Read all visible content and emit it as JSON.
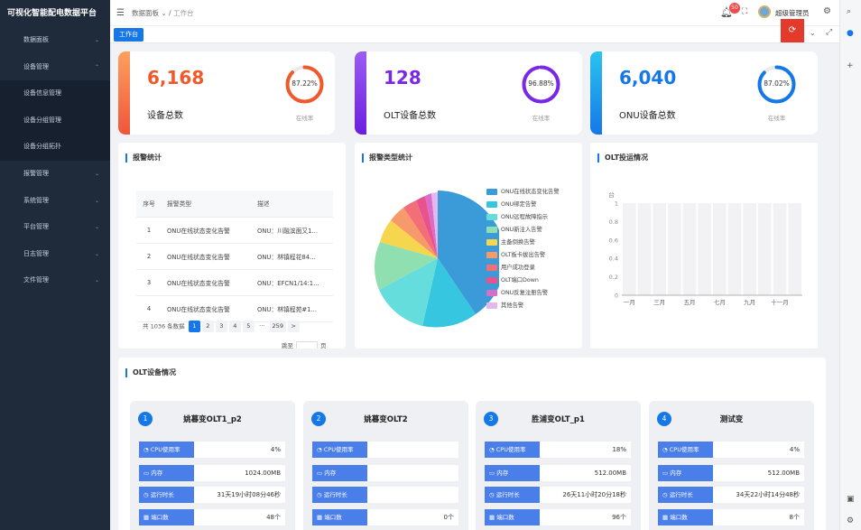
{
  "app": {
    "title": "可视化智能配电数据平台"
  },
  "sidebar": {
    "items": [
      {
        "label": "数据面板",
        "chev": "⌄"
      },
      {
        "label": "设备管理",
        "chev": "⌃"
      },
      {
        "label": "设备信息管理",
        "chev": ""
      },
      {
        "label": "设备分组管理",
        "chev": ""
      },
      {
        "label": "设备分组拓扑",
        "chev": ""
      },
      {
        "label": "报警管理",
        "chev": "⌄"
      },
      {
        "label": "系统管理",
        "chev": "⌄"
      },
      {
        "label": "平台管理",
        "chev": "⌄"
      },
      {
        "label": "日志管理",
        "chev": "⌄"
      },
      {
        "label": "文件管理",
        "chev": "⌄"
      }
    ]
  },
  "header": {
    "breadcrumb": "数据面板 ⌄ / ",
    "breadcrumb_current": "工作台",
    "notify_count": "50",
    "user": "超级管理员"
  },
  "tabs": {
    "active": "工作台"
  },
  "stats": [
    {
      "value": "6,168",
      "label": "设备总数",
      "pct": "87.22%",
      "pct_label": "在线率",
      "ratio": 0.8722,
      "color": "#f05a2a",
      "grad_top": "#fda05f",
      "grad_bot": "#f0553c"
    },
    {
      "value": "128",
      "label": "OLT设备总数",
      "pct": "96.88%",
      "pct_label": "在线率",
      "ratio": 0.9688,
      "color": "#7a28e8",
      "grad_top": "#9b5cf2",
      "grad_bot": "#6a1fe0"
    },
    {
      "value": "6,040",
      "label": "ONU设备总数",
      "pct": "87.02%",
      "pct_label": "在线率",
      "ratio": 0.8702,
      "color": "#1677e8",
      "grad_top": "#29c4f0",
      "grad_bot": "#1677e8"
    }
  ],
  "alarm_stats": {
    "title": "报警统计",
    "headers": [
      "序号",
      "报警类型",
      "描述"
    ],
    "rows": [
      [
        "1",
        "ONU在线状态变化告警",
        "ONU：川融滨面又1..."
      ],
      [
        "2",
        "ONU在线状态变化告警",
        "ONU：林镇程花84..."
      ],
      [
        "3",
        "ONU在线状态变化告警",
        "ONU：EFCN1/14:1..."
      ],
      [
        "4",
        "ONU在线状态变化告警",
        "ONU：林镇程苑#1..."
      ]
    ],
    "pager": {
      "total": "共 1036 条数据",
      "pages": [
        "1",
        "2",
        "3",
        "4",
        "5",
        "···",
        "259",
        ">"
      ],
      "goto": "跳至",
      "page_unit": "页"
    }
  },
  "alarm_types": {
    "title": "报警类型统计",
    "legend": [
      {
        "label": "ONU在线状态变化告警",
        "color": "#3b9bd8"
      },
      {
        "label": "ONU绑定告警",
        "color": "#37c6e0"
      },
      {
        "label": "ONU远程故障指示",
        "color": "#66dddd"
      },
      {
        "label": "ONU新注入告警",
        "color": "#8fdfb0"
      },
      {
        "label": "主备倒换告警",
        "color": "#f7d64f"
      },
      {
        "label": "OLT板卡拔出告警",
        "color": "#f79a6b"
      },
      {
        "label": "用户成功登录",
        "color": "#f36f78"
      },
      {
        "label": "OLT端口Down",
        "color": "#e8528f"
      },
      {
        "label": "ONU反复注册告警",
        "color": "#d86ec8"
      },
      {
        "label": "其他告警",
        "color": "#e0b9ee"
      }
    ]
  },
  "chart_data": {
    "type": "bar",
    "title": "OLT投运情况",
    "ylabel": "台",
    "ylim": [
      0,
      1
    ],
    "yticks": [
      "0",
      "0.2",
      "0.4",
      "0.6",
      "0.8",
      "1"
    ],
    "categories": [
      "一月",
      "二月",
      "三月",
      "四月",
      "五月",
      "六月",
      "七月",
      "八月",
      "九月",
      "十月",
      "十一月",
      "十二月"
    ],
    "x_labels_shown": [
      "一月",
      "三月",
      "五月",
      "七月",
      "九月",
      "十一月"
    ],
    "values": [
      0,
      0,
      0,
      0,
      0,
      0,
      0,
      0,
      0,
      0,
      0,
      0
    ]
  },
  "olt_section": {
    "title": "OLT设备情况",
    "devices": [
      {
        "index": "1",
        "name": "姚暮变OLT1_p2",
        "cpu_label": "CPU使用率",
        "cpu": "4%",
        "mem_label": "内存",
        "mem": "1024.00MB",
        "uptime_label": "运行时长",
        "uptime": "31天19小时08分46秒",
        "ports_label": "端口数",
        "ports": "48个"
      },
      {
        "index": "2",
        "name": "姚暮变OLT2",
        "cpu_label": "CPU使用率",
        "cpu": "",
        "mem_label": "内存",
        "mem": "",
        "uptime_label": "运行时长",
        "uptime": "",
        "ports_label": "端口数",
        "ports": "0个"
      },
      {
        "index": "3",
        "name": "胜浦变OLT_p1",
        "cpu_label": "CPU使用率",
        "cpu": "18%",
        "mem_label": "内存",
        "mem": "512.00MB",
        "uptime_label": "运行时长",
        "uptime": "26天11小时20分18秒",
        "ports_label": "端口数",
        "ports": "96个"
      },
      {
        "index": "4",
        "name": "测试变",
        "cpu_label": "CPU使用率",
        "cpu": "4%",
        "mem_label": "内存",
        "mem": "512.00MB",
        "uptime_label": "运行时长",
        "uptime": "34天22小时14分48秒",
        "ports_label": "端口数",
        "ports": "8个"
      }
    ]
  }
}
